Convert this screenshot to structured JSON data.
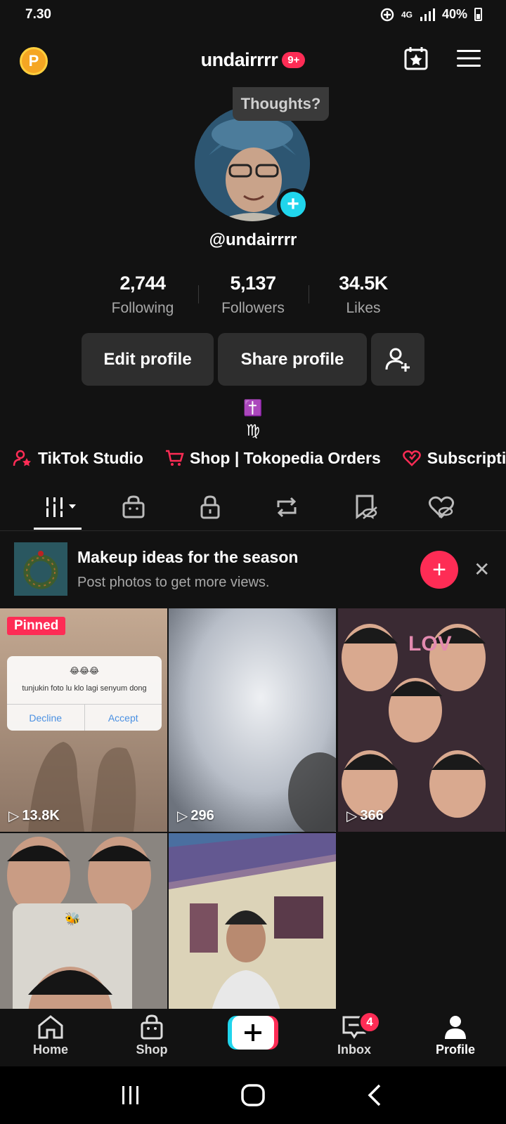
{
  "status": {
    "time": "7.30",
    "network": "4G",
    "battery": "40%"
  },
  "header": {
    "username": "undairrrr",
    "notif_badge": "9+"
  },
  "profile": {
    "thought_bubble": "Thoughts?",
    "handle": "@undairrrr",
    "bio": [
      "✝️",
      "♍"
    ]
  },
  "stats": [
    {
      "value": "2,744",
      "label": "Following"
    },
    {
      "value": "5,137",
      "label": "Followers"
    },
    {
      "value": "34.5K",
      "label": "Likes"
    }
  ],
  "actions": {
    "edit": "Edit profile",
    "share": "Share profile"
  },
  "links": [
    {
      "label": "TikTok Studio"
    },
    {
      "label": "Shop | Tokopedia Orders"
    },
    {
      "label": "Subscriptio"
    }
  ],
  "promo": {
    "title": "Makeup ideas for the season",
    "subtitle": "Post photos to get more views."
  },
  "videos": [
    {
      "views": "13.8K",
      "pinned": "Pinned",
      "card_emoji": "😂😂😂",
      "card_text": "tunjukin foto lu klo lagi senyum dong",
      "decline": "Decline",
      "accept": "Accept"
    },
    {
      "views": "296"
    },
    {
      "views": "366"
    },
    {
      "views": ""
    },
    {
      "views": ""
    }
  ],
  "nav": {
    "home": "Home",
    "shop": "Shop",
    "inbox": "Inbox",
    "profile": "Profile",
    "inbox_badge": "4"
  },
  "colors": {
    "accent": "#fe2c55",
    "cyan": "#20d5ec",
    "bg": "#121212"
  }
}
